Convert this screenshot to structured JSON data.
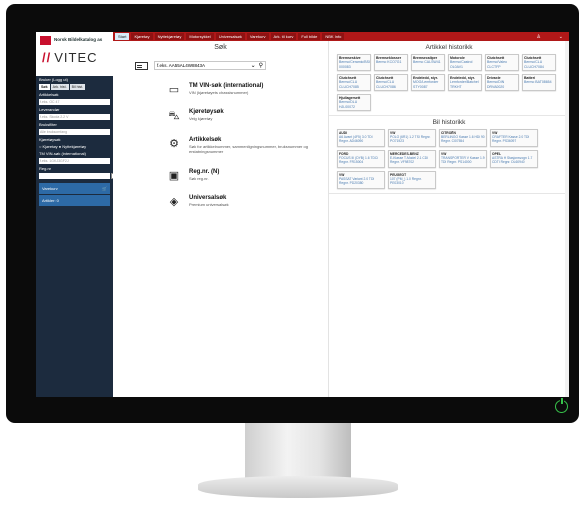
{
  "sidebar": {
    "brand_text": "Norsk Bildelkatalog as",
    "logo_text": "VITEC",
    "user_label": "Bruker (Logg ut)",
    "tabs": [
      "Søk",
      "Ark. hist.",
      "Bil hist."
    ],
    "field_regnr_label": "Artikkelsøk",
    "field_regnr_placeholder": "f.eks. OC 47",
    "field2_label": "Leverandør",
    "field2_placeholder": "f.eks. Skoda 2.2 V",
    "field3_label": "Bruksfilter",
    "field3_value": "Alle bruksomfang",
    "field4_label": "Kjøretøysøk",
    "radio1": "Kjøretøy",
    "radio2": "Nyttekjøretøy",
    "field5_label": "TM VIN-søk (international)",
    "field5_placeholder": "f.eks. 1GKJ3GF2J",
    "field6_label": "Reg.nr",
    "nav_cart": "Varekurv",
    "nav_saved": "Artikler: 0"
  },
  "tabs": [
    {
      "label": "Start",
      "active": true
    },
    {
      "label": "Kjøretøy"
    },
    {
      "label": "Nyttekjøretøy"
    },
    {
      "label": "Motorsykkel"
    },
    {
      "label": "Universalsøk"
    },
    {
      "label": "Varekurv"
    },
    {
      "label": "Ark. til kurv"
    },
    {
      "label": "Full bilde"
    },
    {
      "label": "NBK Info"
    }
  ],
  "search": {
    "title": "Søk",
    "combo_value": "f.eks. AA55AL4W8843A",
    "items": [
      {
        "title": "TM VIN-søk (international)",
        "sub": "VIN (kjøretøyets chassisnummer)",
        "icon": "globe-icon"
      },
      {
        "title": "Kjøretøysøk",
        "sub": "Velg kjøretøy",
        "icon": "car-icon"
      },
      {
        "title": "Artikkelsøk",
        "sub": "Søk for artikkelnummer, sammenligningsnummer, bruksnummer og erstatningsnummer",
        "icon": "part-icon"
      },
      {
        "title": "Reg.nr. (N)",
        "sub": "Søk reg.nr.",
        "icon": "plate-icon"
      },
      {
        "title": "Universalsøk",
        "sub": "Premium universalsøk",
        "icon": "universal-icon"
      }
    ]
  },
  "article_history": {
    "title": "Artikkel historikk",
    "items": [
      {
        "name": "Bremseskive",
        "ref": "Bermo/Ceramic/BSI 000083"
      },
      {
        "name": "Bremseklosser",
        "ref": "Bermo KCO7G1"
      },
      {
        "name": "Bremsecaliper",
        "ref": "Bermo CALSW41"
      },
      {
        "name": "Motorole",
        "ref": "Bermo/Castrol OL0AV1"
      },
      {
        "name": "Clutchsett",
        "ref": "Bermo/Valeo CLCTFP"
      },
      {
        "name": "Clutchsett",
        "ref": "Bermo/CLU CLUCH7084"
      },
      {
        "name": "Clutchsett",
        "ref": "Bermo/CLU CLUCH7085"
      },
      {
        "name": "Clutchsett",
        "ref": "Bermo/CLU CLUCH7086"
      },
      {
        "name": "Endeledd, styr.",
        "ref": "MOG/Lemforder STY0087"
      },
      {
        "name": "Endeledd, styr.",
        "ref": "Lemforder/Batchel TRKHT"
      },
      {
        "name": "Drivaxle",
        "ref": "Bermo/DIN DRVA0020"
      },
      {
        "name": "Batteri",
        "ref": "Bermo BAT08654"
      },
      {
        "name": "Hjullagersett",
        "ref": "Bermo/DLU HJL00072"
      }
    ]
  },
  "car_history": {
    "title": "Bil historikk",
    "items": [
      {
        "name": "AUDI",
        "ref": "A6 Avant (4F5) 3.0 TDI Regnr. AD46090"
      },
      {
        "name": "VW",
        "ref": "POLO (6R1) 1.2 TSI Regnr. PO71923"
      },
      {
        "name": "CITROËN",
        "ref": "BERLINGO Kasse 1.6 HDi 90 Regnr. CI07554"
      },
      {
        "name": "VW",
        "ref": "CRAFTER Kasse 2.0 TDI Regnr. PS36097"
      },
      {
        "name": "FORD",
        "ref": "FOCUS III (DYB) 1.6 TDCi Regnr. FR15004"
      },
      {
        "name": "MERCEDES-BENZ",
        "ref": "E-Klasse T-Model 2.1 CDI Regnr. VF98702"
      },
      {
        "name": "VW",
        "ref": "TRANSPORTER V Kasse 1.9 TDI Regnr. PS14000"
      },
      {
        "name": "OPEL",
        "ref": "ASTRA H Stasjonsvogn 1.7 CDTI Regnr. DL60940"
      },
      {
        "name": "VW",
        "ref": "PASSAT Variant 2.0 TDI Regnr. PD20380"
      },
      {
        "name": "PEUGEOT",
        "ref": "107 (PM_) 1.0 Regnr. PE03010"
      }
    ]
  }
}
